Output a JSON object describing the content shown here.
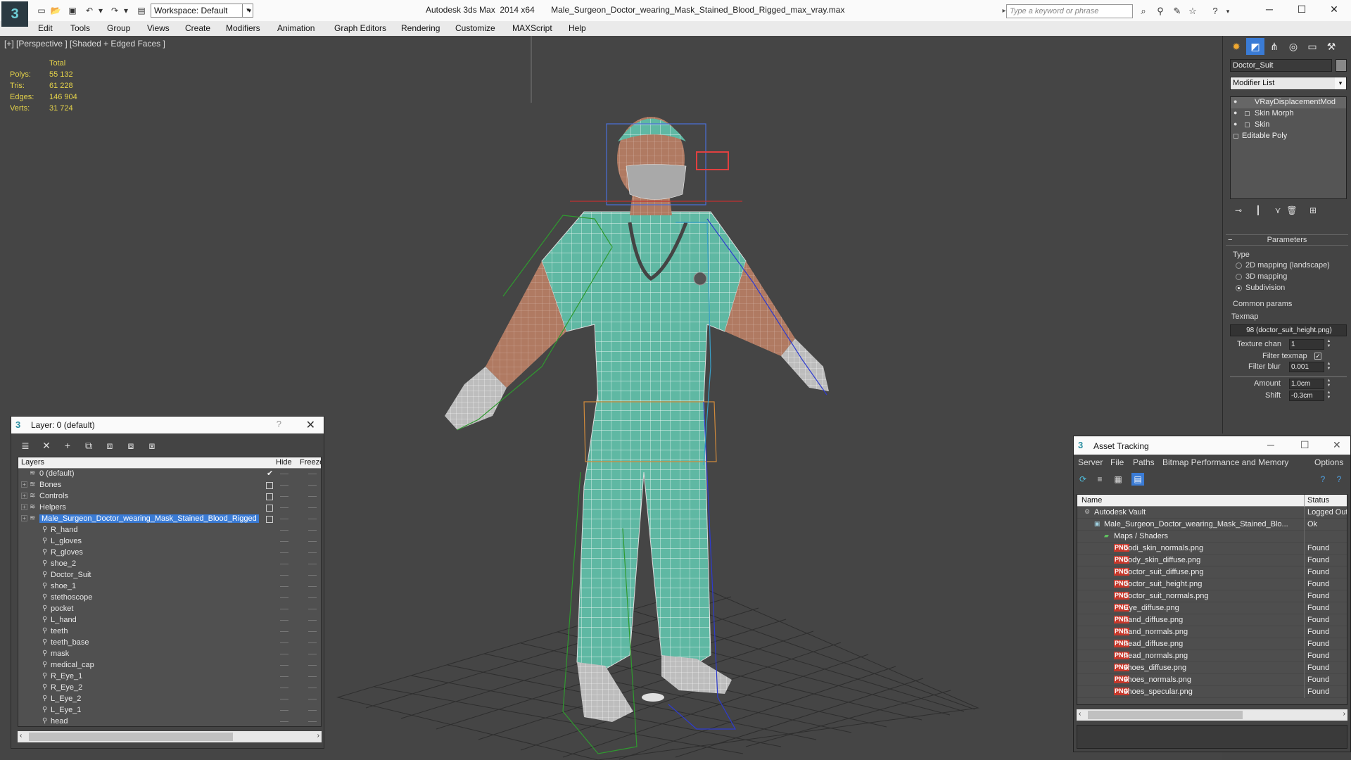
{
  "app": {
    "logo": "3",
    "workspace": "Workspace: Default",
    "title": "Autodesk 3ds Max  2014 x64       Male_Surgeon_Doctor_wearing_Mask_Stained_Blood_Rigged_max_vray.max",
    "search_placeholder": "Type a keyword or phrase"
  },
  "menu": [
    "Edit",
    "Tools",
    "Group",
    "Views",
    "Create",
    "Modifiers",
    "Animation",
    "Graph Editors",
    "Rendering",
    "Customize",
    "MAXScript",
    "Help"
  ],
  "viewport": {
    "label": "[+] [Perspective ] [Shaded + Edged Faces ]",
    "stats_header": "Total",
    "stats": [
      {
        "label": "Polys:",
        "value": "55 132"
      },
      {
        "label": "Tris:",
        "value": "61 228"
      },
      {
        "label": "Edges:",
        "value": "146 904"
      },
      {
        "label": "Verts:",
        "value": "31 724"
      }
    ]
  },
  "layer_dialog": {
    "title": "Layer: 0 (default)",
    "help": "?",
    "columns": {
      "name": "Layers",
      "hide": "Hide",
      "freeze": "Freeze"
    },
    "rows": [
      {
        "name": "0 (default)",
        "level": 0,
        "expand": false,
        "kind": "layer",
        "hide": "check"
      },
      {
        "name": "Bones",
        "level": 0,
        "expand": true,
        "kind": "layer",
        "hide": "box"
      },
      {
        "name": "Controls",
        "level": 0,
        "expand": true,
        "kind": "layer",
        "hide": "box"
      },
      {
        "name": "Helpers",
        "level": 0,
        "expand": true,
        "kind": "layer",
        "hide": "box"
      },
      {
        "name": "Male_Surgeon_Doctor_wearing_Mask_Stained_Blood_Rigged",
        "level": 0,
        "expand": true,
        "kind": "layer",
        "hide": "box",
        "selected": true
      },
      {
        "name": "R_hand",
        "level": 1,
        "kind": "object"
      },
      {
        "name": "L_gloves",
        "level": 1,
        "kind": "object"
      },
      {
        "name": "R_gloves",
        "level": 1,
        "kind": "object"
      },
      {
        "name": "shoe_2",
        "level": 1,
        "kind": "object"
      },
      {
        "name": "Doctor_Suit",
        "level": 1,
        "kind": "object"
      },
      {
        "name": "shoe_1",
        "level": 1,
        "kind": "object"
      },
      {
        "name": "stethoscope",
        "level": 1,
        "kind": "object"
      },
      {
        "name": "pocket",
        "level": 1,
        "kind": "object"
      },
      {
        "name": "L_hand",
        "level": 1,
        "kind": "object"
      },
      {
        "name": "teeth",
        "level": 1,
        "kind": "object"
      },
      {
        "name": "teeth_base",
        "level": 1,
        "kind": "object"
      },
      {
        "name": "mask",
        "level": 1,
        "kind": "object"
      },
      {
        "name": "medical_cap",
        "level": 1,
        "kind": "object"
      },
      {
        "name": "R_Eye_1",
        "level": 1,
        "kind": "object"
      },
      {
        "name": "R_Eye_2",
        "level": 1,
        "kind": "object"
      },
      {
        "name": "L_Eye_2",
        "level": 1,
        "kind": "object"
      },
      {
        "name": "L_Eye_1",
        "level": 1,
        "kind": "object"
      },
      {
        "name": "head",
        "level": 1,
        "kind": "object"
      }
    ]
  },
  "command_panel": {
    "object_name": "Doctor_Suit",
    "modifier_list": "Modifier List",
    "stack": [
      "VRayDisplacementMod",
      "Skin Morph",
      "Skin",
      "Editable Poly"
    ],
    "parameters_title": "Parameters",
    "type_label": "Type",
    "type_options": [
      "2D mapping (landscape)",
      "3D mapping",
      "Subdivision"
    ],
    "type_selected": "Subdivision",
    "common_params": "Common params",
    "texmap_label": "Texmap",
    "texmap_value": "98 (doctor_suit_height.png)",
    "texture_chan_label": "Texture chan",
    "texture_chan_value": "1",
    "filter_texmap_label": "Filter texmap",
    "filter_blur_label": "Filter blur",
    "filter_blur_value": "0.001",
    "amount_label": "Amount",
    "amount_value": "1.0cm",
    "shift_label": "Shift",
    "shift_value": "-0.3cm"
  },
  "asset_tracking": {
    "title": "Asset Tracking",
    "menu": [
      "Server",
      "File",
      "Paths",
      "Bitmap Performance and Memory",
      "Options"
    ],
    "columns": {
      "name": "Name",
      "status": "Status"
    },
    "rows": [
      {
        "name": "Autodesk Vault",
        "status": "Logged Out",
        "kind": "vault",
        "level": 0
      },
      {
        "name": "Male_Surgeon_Doctor_wearing_Mask_Stained_Blo...",
        "status": "Ok",
        "kind": "max",
        "level": 1
      },
      {
        "name": "Maps / Shaders",
        "status": "",
        "kind": "maps",
        "level": 2
      },
      {
        "name": "bodi_skin_normals.png",
        "status": "Found",
        "kind": "png",
        "level": 3
      },
      {
        "name": "body_skin_diffuse.png",
        "status": "Found",
        "kind": "png",
        "level": 3
      },
      {
        "name": "doctor_suit_diffuse.png",
        "status": "Found",
        "kind": "png",
        "level": 3
      },
      {
        "name": "doctor_suit_height.png",
        "status": "Found",
        "kind": "png",
        "level": 3
      },
      {
        "name": "doctor_suit_normals.png",
        "status": "Found",
        "kind": "png",
        "level": 3
      },
      {
        "name": "Eye_diffuse.png",
        "status": "Found",
        "kind": "png",
        "level": 3
      },
      {
        "name": "hand_diffuse.png",
        "status": "Found",
        "kind": "png",
        "level": 3
      },
      {
        "name": "hand_normals.png",
        "status": "Found",
        "kind": "png",
        "level": 3
      },
      {
        "name": "head_diffuse.png",
        "status": "Found",
        "kind": "png",
        "level": 3
      },
      {
        "name": "head_normals.png",
        "status": "Found",
        "kind": "png",
        "level": 3
      },
      {
        "name": "shoes_diffuse.png",
        "status": "Found",
        "kind": "png",
        "level": 3
      },
      {
        "name": "shoes_normals.png",
        "status": "Found",
        "kind": "png",
        "level": 3
      },
      {
        "name": "shoes_specular.png",
        "status": "Found",
        "kind": "png",
        "level": 3
      }
    ]
  },
  "colors": {
    "viewport_bg": "#454545",
    "stats_text": "#e6d44a",
    "selection": "#3a7bd5",
    "suit": "#5fb8a3",
    "wire": "#ffffff",
    "bone_green": "#2f9a2f",
    "bone_blue": "#2d3bd0"
  }
}
